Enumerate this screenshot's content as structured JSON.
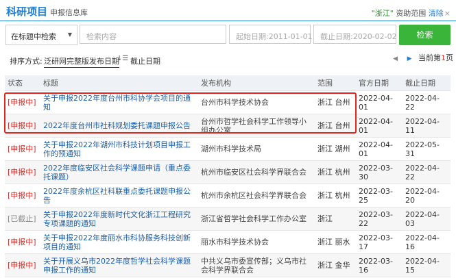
{
  "header": {
    "title": "科研项目",
    "subtitle": "申报信息库",
    "scope_region": "\"浙江\"",
    "scope_label": "资助范围",
    "clear_label": "清除",
    "clear_mark": "×"
  },
  "search": {
    "field_select": "在标题中检索",
    "keyword_placeholder": "检索内容",
    "start_placeholder": "起始日期:2011-01-01",
    "end_placeholder": "截止日期:2020-02-02",
    "button": "检索"
  },
  "sort": {
    "label": "排序方式:",
    "option_active": "泛研网完整版发布日期",
    "option_other": "截止日期"
  },
  "pager": {
    "prefix": "当前第",
    "page": "1",
    "suffix": "页"
  },
  "table": {
    "headers": [
      "状态",
      "标题",
      "发布机构",
      "范围",
      "官方日期",
      "截止日期"
    ],
    "rows": [
      {
        "status": "[申报中]",
        "title": "关于申报2022年度台州市科协学会项目的通知",
        "org": "台州市科学技术协会",
        "scope": "浙江 台州",
        "official": "2022-04-01",
        "deadline": "2022-04-22"
      },
      {
        "status": "[申报中]",
        "title": "2022年度台州市社科规划委托课题申报公告",
        "org": "台州市哲学社会科学工作领导小组办公室",
        "scope": "浙江 台州",
        "official": "2022-04-01",
        "deadline": "2022-04-11"
      },
      {
        "status": "[申报中]",
        "title": "关于申报2022年湖州市科技计划项目申报工作的预通知",
        "org": "湖州市科学技术局",
        "scope": "浙江 湖州",
        "official": "2022-04-01",
        "deadline": "2022-05-31"
      },
      {
        "status": "[申报中]",
        "title": "2022年度临安区社会科学课题申请（重点委托课题）",
        "org": "杭州市临安区社会科学界联合会",
        "scope": "浙江 杭州",
        "official": "2022-03-30",
        "deadline": "2022-04-22"
      },
      {
        "status": "[申报中]",
        "title": "2022年度余杭区社科联重点委托课题申报公告",
        "org": "杭州市余杭区社会科学界联合会",
        "scope": "浙江 杭州",
        "official": "2022-03-25",
        "deadline": "2022-04-20"
      },
      {
        "status": "[已截止]",
        "title": "关于申报2022年度新时代文化浙江工程研究专项课题的通知",
        "org": "浙江省哲学社会科学工作办公室",
        "scope": "浙江",
        "official": "2022-03-22",
        "deadline": "2022-04-03"
      },
      {
        "status": "[申报中]",
        "title": "关于申报2022年度丽水市科协服务科技创新项目的通知",
        "org": "丽水市科学技术协会",
        "scope": "浙江 丽水",
        "official": "2022-03-17",
        "deadline": "2022-04-16"
      },
      {
        "status": "[申报中]",
        "title": "关于开展义乌市2022年度哲学社会科学课题申报工作的通知",
        "org": "中共义乌市委宣传部；义乌市社会科学界联合会",
        "scope": "浙江 金华",
        "official": "2022-03-16",
        "deadline": "2022-04-15"
      }
    ]
  },
  "colors": {
    "accent": "#1e7ed0",
    "search_button": "#3ab53a",
    "status_active": "#c9312b",
    "highlight_box": "#e0261e"
  }
}
